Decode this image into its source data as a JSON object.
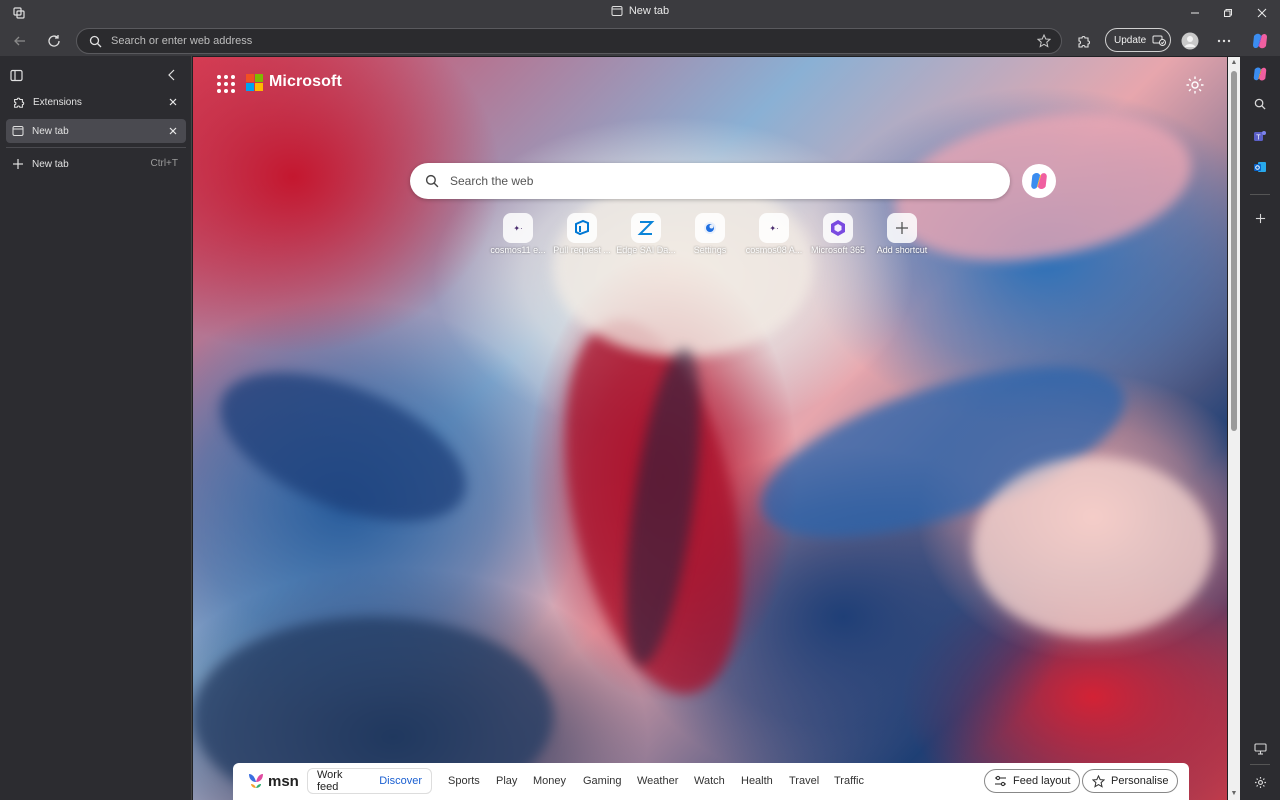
{
  "window": {
    "title": "New tab"
  },
  "toolbar": {
    "address_placeholder": "Search or enter web address",
    "update_label": "Update"
  },
  "tabpane": {
    "items": [
      {
        "label": "Extensions"
      },
      {
        "label": "New tab"
      }
    ],
    "new_tab_label": "New tab",
    "new_tab_shortcut": "Ctrl+T"
  },
  "ntp": {
    "brand": "Microsoft",
    "search_placeholder": "Search the web",
    "shortcuts": [
      {
        "label": "cosmos11 e..."
      },
      {
        "label": "Pull request ..."
      },
      {
        "label": "Edge SAI Da..."
      },
      {
        "label": "Settings"
      },
      {
        "label": "cosmos08 A..."
      },
      {
        "label": "Microsoft 365"
      },
      {
        "label": "Add shortcut"
      }
    ]
  },
  "feed": {
    "logo": "msn",
    "toggle": [
      "Work feed",
      "Discover"
    ],
    "nav": [
      "Sports",
      "Play",
      "Money",
      "Gaming",
      "Weather",
      "Watch",
      "Health",
      "Travel",
      "Traffic"
    ],
    "feed_layout_label": "Feed layout",
    "personalise_label": "Personalise"
  },
  "colors": {
    "accent": "#1a5fd1",
    "chrome": "#3b3b3f",
    "tabpane": "#2c2c30"
  }
}
